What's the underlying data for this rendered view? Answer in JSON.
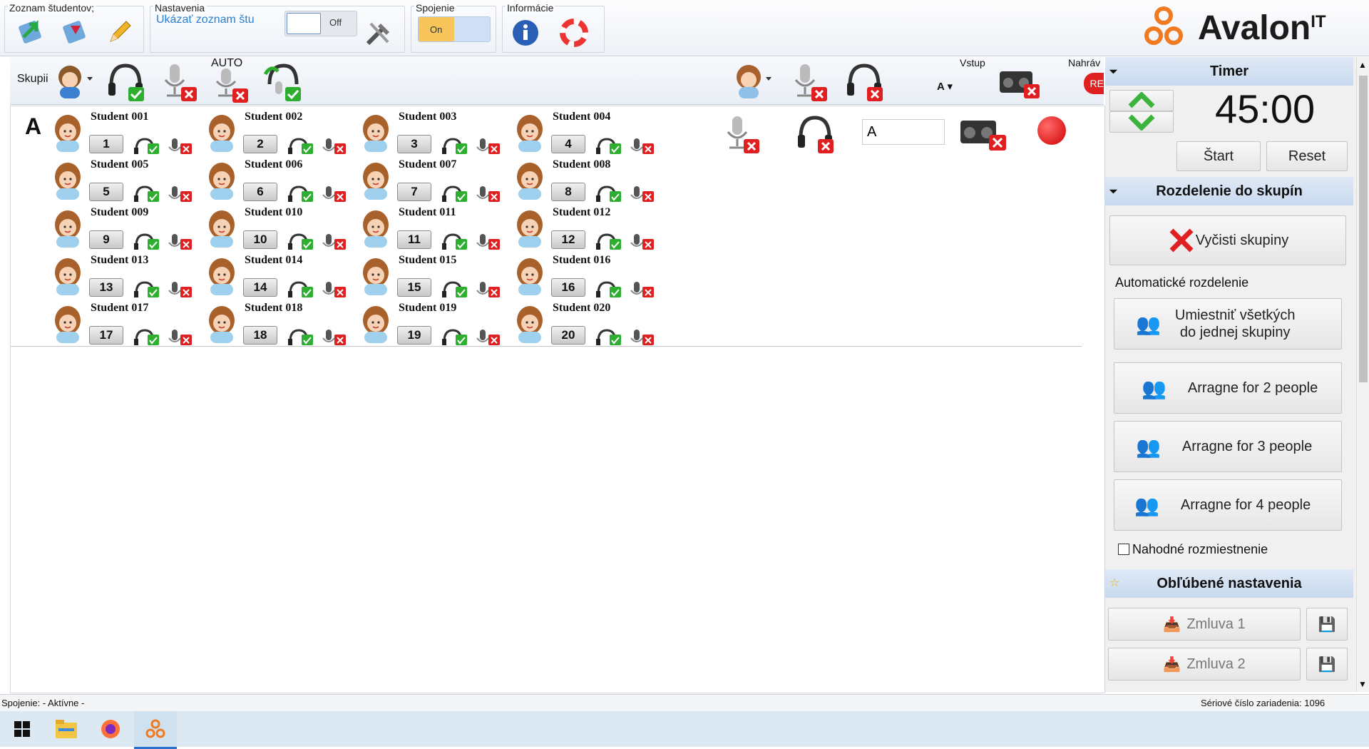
{
  "ribbon": {
    "groups": [
      {
        "title": "Zoznam študentov;"
      },
      {
        "title": "Nastavenia"
      },
      {
        "title": "Spojenie"
      },
      {
        "title": "Informácie"
      }
    ],
    "show_list_link": "Ukázať zoznam štu",
    "settings_toggle": "Off",
    "connection_toggle": "On",
    "brand": "Avalon",
    "brand_sup": "IT"
  },
  "toolbar": {
    "group_label": "Skupii",
    "auto_label": "AUTO",
    "input_label": "Vstup",
    "input_value": "A",
    "record_label": "Nahráv",
    "rec_badge": "RE"
  },
  "main": {
    "group_letter": "A",
    "group_input": "A",
    "students": [
      {
        "name": "Student 001",
        "num": "1"
      },
      {
        "name": "Student 002",
        "num": "2"
      },
      {
        "name": "Student 003",
        "num": "3"
      },
      {
        "name": "Student 004",
        "num": "4"
      },
      {
        "name": "Student 005",
        "num": "5"
      },
      {
        "name": "Student 006",
        "num": "6"
      },
      {
        "name": "Student 007",
        "num": "7"
      },
      {
        "name": "Student 008",
        "num": "8"
      },
      {
        "name": "Student 009",
        "num": "9"
      },
      {
        "name": "Student 010",
        "num": "10"
      },
      {
        "name": "Student 011",
        "num": "11"
      },
      {
        "name": "Student 012",
        "num": "12"
      },
      {
        "name": "Student 013",
        "num": "13"
      },
      {
        "name": "Student 014",
        "num": "14"
      },
      {
        "name": "Student 015",
        "num": "15"
      },
      {
        "name": "Student 016",
        "num": "16"
      },
      {
        "name": "Student 017",
        "num": "17"
      },
      {
        "name": "Student 018",
        "num": "18"
      },
      {
        "name": "Student 019",
        "num": "19"
      },
      {
        "name": "Student 020",
        "num": "20"
      }
    ]
  },
  "sidebar": {
    "timer": {
      "title": "Timer",
      "value": "45:00",
      "start": "Štart",
      "reset": "Reset"
    },
    "groups": {
      "title": "Rozdelenie do skupín",
      "clear": "Vyčisti skupiny",
      "auto_title": "Automatické rozdelenie",
      "all_one_line1": "Umiestniť všetkých",
      "all_one_line2": "do jednej skupiny",
      "arr2": "Arragne for 2 people",
      "arr3": "Arragne for 3 people",
      "arr4": "Arragne for 4 people",
      "random": "Nahodné rozmiestnenie"
    },
    "favorites": {
      "title": "Obľúbené nastavenia",
      "item1": "Zmluva 1",
      "item2": "Zmluva 2"
    }
  },
  "status": {
    "left": "Spojenie: - Aktívne -",
    "right": "Sériové číslo zariadenia: 1096"
  },
  "colors": {
    "accent": "#2a6fc9",
    "ok": "#2eae2e",
    "err": "#e02020",
    "timerArrow": "#3cb43c"
  }
}
